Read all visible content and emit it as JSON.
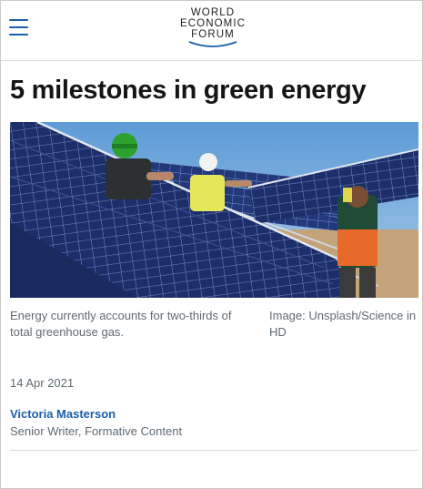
{
  "header": {
    "logo_lines": [
      "WORLD",
      "ECONOMIC",
      "FORUM"
    ],
    "menu_icon": "hamburger-menu-icon"
  },
  "article": {
    "title": "5 milestones in green energy",
    "image": {
      "caption": "Energy currently accounts for two-thirds of total greenhouse gas.",
      "credit": "Image: Unsplash/Science in HD"
    },
    "date": "14 Apr 2021",
    "author": {
      "name": "Victoria Masterson",
      "role": "Senior Writer, Formative Content"
    }
  },
  "colors": {
    "accent": "#1b5fa8",
    "muted_text": "#5f6a73",
    "sky": "#6fa6d8",
    "panel": "#1a2f6b"
  }
}
